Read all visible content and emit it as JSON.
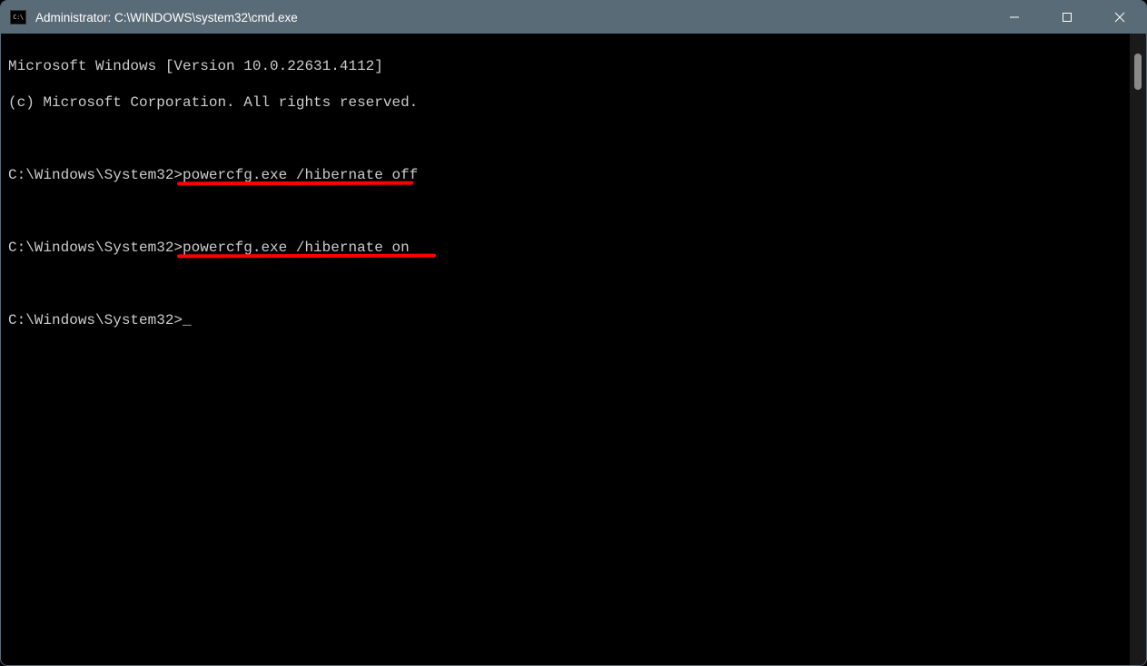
{
  "titlebar": {
    "icon_label": "C:\\",
    "title": "Administrator: C:\\WINDOWS\\system32\\cmd.exe"
  },
  "terminal": {
    "header_line1": "Microsoft Windows [Version 10.0.22631.4112]",
    "header_line2": "(c) Microsoft Corporation. All rights reserved.",
    "prompt": "C:\\Windows\\System32>",
    "lines": [
      {
        "prompt": "C:\\Windows\\System32>",
        "command": "powercfg.exe /hibernate off",
        "underline": true
      },
      {
        "prompt": "C:\\Windows\\System32>",
        "command": "powercfg.exe /hibernate on",
        "underline": true
      },
      {
        "prompt": "C:\\Windows\\System32>",
        "command": "",
        "cursor": true
      }
    ]
  },
  "annotations": {
    "underline_color": "#ff0000"
  }
}
